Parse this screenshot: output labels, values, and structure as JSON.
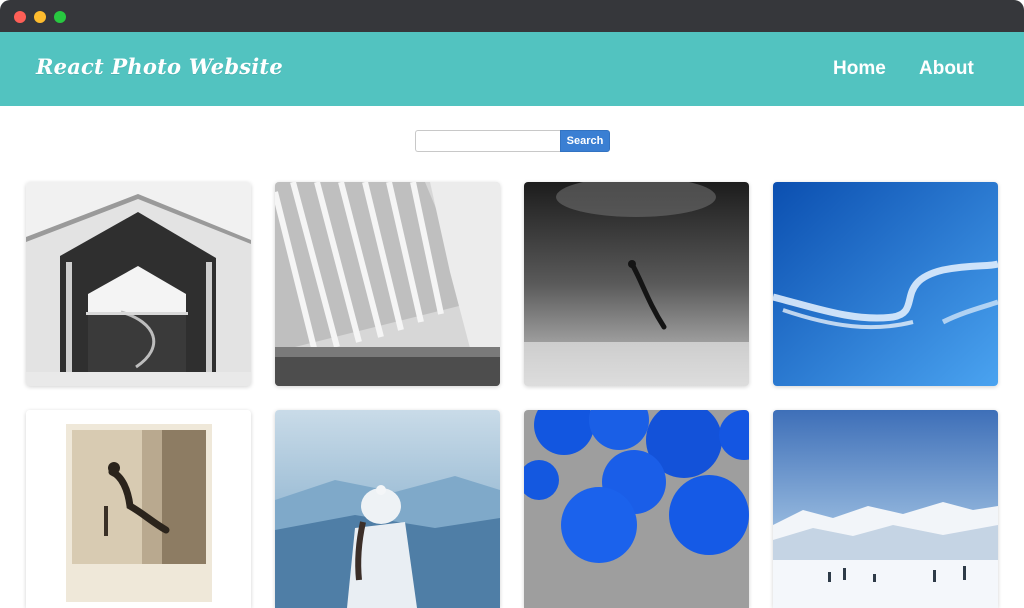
{
  "window": {
    "controls": [
      "close",
      "minimize",
      "maximize"
    ]
  },
  "header": {
    "brand": "React Photo Website",
    "nav": [
      {
        "label": "Home"
      },
      {
        "label": "About"
      }
    ],
    "background_color": "#52c3c0"
  },
  "search": {
    "value": "",
    "placeholder": "",
    "button_label": "Search",
    "button_color": "#3a7fd3"
  },
  "photos": [
    {
      "subject": "white-barn-building"
    },
    {
      "subject": "white-ribbed-architecture"
    },
    {
      "subject": "underwater-swimmer"
    },
    {
      "subject": "blue-sky-clouds"
    },
    {
      "subject": "polaroid-seated-person"
    },
    {
      "subject": "woman-white-beanie-mountains"
    },
    {
      "subject": "blue-balloons"
    },
    {
      "subject": "snowy-mountains"
    }
  ]
}
